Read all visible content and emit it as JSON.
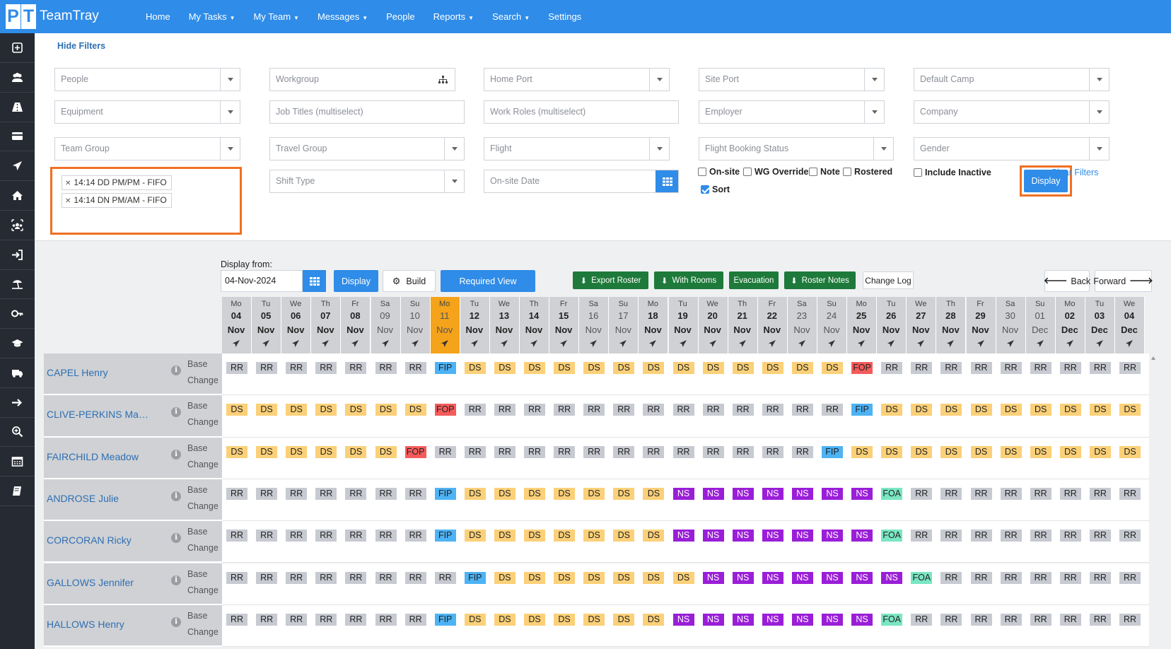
{
  "app": {
    "name": "TeamTray",
    "logo_letters": "PT"
  },
  "nav": [
    {
      "label": "Home",
      "caret": false
    },
    {
      "label": "My Tasks",
      "caret": true
    },
    {
      "label": "My Team",
      "caret": true
    },
    {
      "label": "Messages",
      "caret": true
    },
    {
      "label": "People",
      "caret": false
    },
    {
      "label": "Reports",
      "caret": true
    },
    {
      "label": "Search",
      "caret": true
    },
    {
      "label": "Settings",
      "caret": false
    }
  ],
  "sidebar_icons": [
    "plus-square-icon",
    "users-icon",
    "road-icon",
    "card-icon",
    "plane-icon",
    "home-icon",
    "team-icon",
    "sign-in-icon",
    "beach-icon",
    "key-icon",
    "graduation-cap-icon",
    "truck-icon",
    "arrow-right-icon",
    "search-plus-icon",
    "calendar-icon",
    "book-icon"
  ],
  "filters": {
    "hide_label": "Hide Filters",
    "people": "People",
    "workgroup": "Workgroup",
    "home_port": "Home Port",
    "site_port": "Site Port",
    "default_camp": "Default Camp",
    "equipment": "Equipment",
    "job_titles": "Job Titles (multiselect)",
    "work_roles": "Work Roles (multiselect)",
    "employer": "Employer",
    "company": "Company",
    "team_group": "Team Group",
    "travel_group": "Travel Group",
    "flight": "Flight",
    "flight_booking_status": "Flight Booking Status",
    "gender": "Gender",
    "shift_type": "Shift Type",
    "onsite_date": "On-site Date",
    "team_tags": [
      "14:14 DD PM/PM - FIFO",
      "14:14 DN PM/AM - FIFO"
    ],
    "checks": {
      "on_site": "On-site",
      "wg_override": "WG Override",
      "note": "Note",
      "rostered": "Rostered",
      "include_inactive": "Include Inactive",
      "sort": "Sort"
    },
    "display": "Display",
    "clear": "Clear Filters"
  },
  "toolbar": {
    "display_from_label": "Display from:",
    "date": "04-Nov-2024",
    "display": "Display",
    "build": "Build",
    "required_view": "Required View",
    "export_roster": "Export Roster",
    "with_rooms": "With Rooms",
    "evacuation": "Evacuation",
    "roster_notes": "Roster Notes",
    "change_log": "Change Log",
    "back": "Back",
    "forward": "Forward"
  },
  "days": [
    {
      "dow": "Mo",
      "d": "04",
      "m": "Nov",
      "bold": true
    },
    {
      "dow": "Tu",
      "d": "05",
      "m": "Nov",
      "bold": true
    },
    {
      "dow": "We",
      "d": "06",
      "m": "Nov",
      "bold": true
    },
    {
      "dow": "Th",
      "d": "07",
      "m": "Nov",
      "bold": true
    },
    {
      "dow": "Fr",
      "d": "08",
      "m": "Nov",
      "bold": true
    },
    {
      "dow": "Sa",
      "d": "09",
      "m": "Nov",
      "bold": false
    },
    {
      "dow": "Su",
      "d": "10",
      "m": "Nov",
      "bold": false
    },
    {
      "dow": "Mo",
      "d": "11",
      "m": "Nov",
      "bold": false,
      "today": true
    },
    {
      "dow": "Tu",
      "d": "12",
      "m": "Nov",
      "bold": true
    },
    {
      "dow": "We",
      "d": "13",
      "m": "Nov",
      "bold": true
    },
    {
      "dow": "Th",
      "d": "14",
      "m": "Nov",
      "bold": true
    },
    {
      "dow": "Fr",
      "d": "15",
      "m": "Nov",
      "bold": true
    },
    {
      "dow": "Sa",
      "d": "16",
      "m": "Nov",
      "bold": false
    },
    {
      "dow": "Su",
      "d": "17",
      "m": "Nov",
      "bold": false
    },
    {
      "dow": "Mo",
      "d": "18",
      "m": "Nov",
      "bold": true
    },
    {
      "dow": "Tu",
      "d": "19",
      "m": "Nov",
      "bold": true
    },
    {
      "dow": "We",
      "d": "20",
      "m": "Nov",
      "bold": true
    },
    {
      "dow": "Th",
      "d": "21",
      "m": "Nov",
      "bold": true
    },
    {
      "dow": "Fr",
      "d": "22",
      "m": "Nov",
      "bold": true
    },
    {
      "dow": "Sa",
      "d": "23",
      "m": "Nov",
      "bold": false
    },
    {
      "dow": "Su",
      "d": "24",
      "m": "Nov",
      "bold": false
    },
    {
      "dow": "Mo",
      "d": "25",
      "m": "Nov",
      "bold": true
    },
    {
      "dow": "Tu",
      "d": "26",
      "m": "Nov",
      "bold": true
    },
    {
      "dow": "We",
      "d": "27",
      "m": "Nov",
      "bold": true
    },
    {
      "dow": "Th",
      "d": "28",
      "m": "Nov",
      "bold": true
    },
    {
      "dow": "Fr",
      "d": "29",
      "m": "Nov",
      "bold": true
    },
    {
      "dow": "Sa",
      "d": "30",
      "m": "Nov",
      "bold": false
    },
    {
      "dow": "Su",
      "d": "01",
      "m": "Dec",
      "bold": false
    },
    {
      "dow": "Mo",
      "d": "02",
      "m": "Dec",
      "bold": true
    },
    {
      "dow": "Tu",
      "d": "03",
      "m": "Dec",
      "bold": true
    },
    {
      "dow": "We",
      "d": "04",
      "m": "Dec",
      "bold": true
    }
  ],
  "row_labels": {
    "base": "Base",
    "change": "Change",
    "info": "i"
  },
  "people": [
    {
      "name": "CAPEL Henry",
      "shifts": [
        "RR",
        "RR",
        "RR",
        "RR",
        "RR",
        "RR",
        "RR",
        "FIP",
        "DS",
        "DS",
        "DS",
        "DS",
        "DS",
        "DS",
        "DS",
        "DS",
        "DS",
        "DS",
        "DS",
        "DS",
        "DS",
        "FOP",
        "RR",
        "RR",
        "RR",
        "RR",
        "RR",
        "RR",
        "RR",
        "RR",
        "RR"
      ]
    },
    {
      "name": "CLIVE-PERKINS Master...",
      "shifts": [
        "DS",
        "DS",
        "DS",
        "DS",
        "DS",
        "DS",
        "DS",
        "FOP",
        "RR",
        "RR",
        "RR",
        "RR",
        "RR",
        "RR",
        "RR",
        "RR",
        "RR",
        "RR",
        "RR",
        "RR",
        "RR",
        "FIP",
        "DS",
        "DS",
        "DS",
        "DS",
        "DS",
        "DS",
        "DS",
        "DS",
        "DS"
      ]
    },
    {
      "name": "FAIRCHILD Meadow",
      "shifts": [
        "DS",
        "DS",
        "DS",
        "DS",
        "DS",
        "DS",
        "FOP",
        "RR",
        "RR",
        "RR",
        "RR",
        "RR",
        "RR",
        "RR",
        "RR",
        "RR",
        "RR",
        "RR",
        "RR",
        "RR",
        "FIP",
        "DS",
        "DS",
        "DS",
        "DS",
        "DS",
        "DS",
        "DS",
        "DS",
        "DS",
        "DS"
      ]
    },
    {
      "name": "ANDROSE Julie",
      "shifts": [
        "RR",
        "RR",
        "RR",
        "RR",
        "RR",
        "RR",
        "RR",
        "FIP",
        "DS",
        "DS",
        "DS",
        "DS",
        "DS",
        "DS",
        "DS",
        "NS",
        "NS",
        "NS",
        "NS",
        "NS",
        "NS",
        "NS",
        "FOA",
        "RR",
        "RR",
        "RR",
        "RR",
        "RR",
        "RR",
        "RR",
        "RR"
      ]
    },
    {
      "name": "CORCORAN Ricky",
      "shifts": [
        "RR",
        "RR",
        "RR",
        "RR",
        "RR",
        "RR",
        "RR",
        "FIP",
        "DS",
        "DS",
        "DS",
        "DS",
        "DS",
        "DS",
        "DS",
        "NS",
        "NS",
        "NS",
        "NS",
        "NS",
        "NS",
        "NS",
        "FOA",
        "RR",
        "RR",
        "RR",
        "RR",
        "RR",
        "RR",
        "RR",
        "RR"
      ]
    },
    {
      "name": "GALLOWS Jennifer",
      "shifts": [
        "RR",
        "RR",
        "RR",
        "RR",
        "RR",
        "RR",
        "RR",
        "RR",
        "FIP",
        "DS",
        "DS",
        "DS",
        "DS",
        "DS",
        "DS",
        "DS",
        "NS",
        "NS",
        "NS",
        "NS",
        "NS",
        "NS",
        "NS",
        "FOA",
        "RR",
        "RR",
        "RR",
        "RR",
        "RR",
        "RR",
        "RR"
      ]
    },
    {
      "name": "HALLOWS Henry",
      "shifts": [
        "RR",
        "RR",
        "RR",
        "RR",
        "RR",
        "RR",
        "RR",
        "FIP",
        "DS",
        "DS",
        "DS",
        "DS",
        "DS",
        "DS",
        "DS",
        "NS",
        "NS",
        "NS",
        "NS",
        "NS",
        "NS",
        "NS",
        "FOA",
        "RR",
        "RR",
        "RR",
        "RR",
        "RR",
        "RR",
        "RR",
        "RR"
      ]
    }
  ],
  "colors": {
    "accent": "#2f8ce8",
    "highlight": "#f07022",
    "today": "#f5a31a",
    "RR": "#c7cad1",
    "DS": "#fbd078",
    "FIP": "#4db3f5",
    "FOP": "#f55b5b",
    "NS": "#9a1ed8",
    "FOA": "#7ae6c3",
    "green": "#1e7a3a"
  }
}
